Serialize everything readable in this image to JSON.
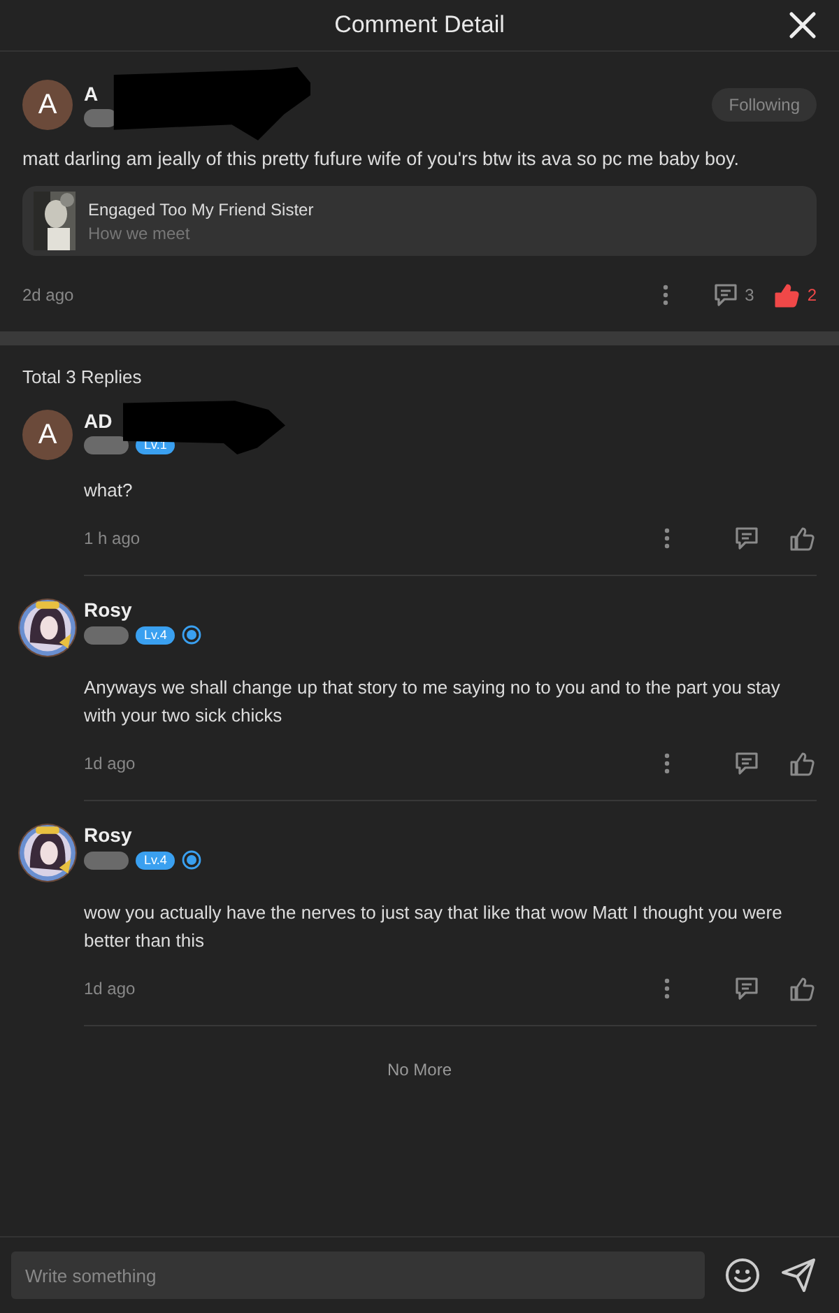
{
  "header": {
    "title": "Comment Detail"
  },
  "comment": {
    "avatar": {
      "kind": "letter",
      "letter": "A"
    },
    "name": "A",
    "redacted": true,
    "follow": {
      "label": "Following",
      "following": true
    },
    "text": "matt darling am jeally of this pretty fufure wife of you'rs btw its ava so pc me baby boy.",
    "story": {
      "title": "Engaged Too My Friend Sister",
      "subtitle": "How we meet"
    },
    "time": "2d ago",
    "reply_count": "3",
    "like_count": "2",
    "liked": true
  },
  "replies_heading": "Total 3 Replies",
  "replies": [
    {
      "avatar": {
        "kind": "letter",
        "letter": "A"
      },
      "name": "AD",
      "redacted": true,
      "level": "Lv.1",
      "verified": false,
      "text": "what?",
      "time": "1 h ago",
      "liked": false
    },
    {
      "name": "Rosy",
      "redacted": false,
      "level": "Lv.4",
      "verified": true,
      "text": "Anyways we shall change up that story to me saying no to you and to the part you stay with your two sick chicks",
      "time": "1d ago",
      "liked": false
    },
    {
      "name": "Rosy",
      "redacted": false,
      "level": "Lv.4",
      "verified": true,
      "text": "wow you actually have the nerves to just say that like that wow Matt I thought you were better than this",
      "time": "1d ago",
      "liked": false
    }
  ],
  "end_note": "No More",
  "composer": {
    "placeholder": "Write something"
  }
}
